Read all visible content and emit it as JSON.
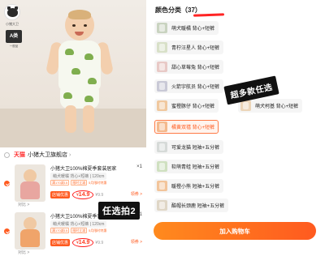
{
  "left": {
    "brand_logo_text": "小猪大卫",
    "grade_badge": "A类",
    "grade_sub": "一般品",
    "store": {
      "platform": "天猫",
      "name": "小猪大卫旗舰店"
    },
    "cart_items": [
      {
        "title": "小猪大卫100%棉夏季套装居家",
        "qty": "×1",
        "sku": "萌犬暖橘 背心+短裤 | 120cm",
        "promo_tags": [
          "满170减15",
          "限时立减",
          "5月限时特惠"
        ],
        "price_label": "店铺优惠",
        "price_currency": "¥",
        "price_value": "14.9",
        "old_price": "¥9.9",
        "coupon_link": "领券 >",
        "thumb_label": "对比 >",
        "thumb_color": "#e8a6a0"
      },
      {
        "title": "小猪大卫100%棉夏季套装居家",
        "qty": "×1",
        "sku": "萌犬暖橘 背心+短裤 | 120cm",
        "promo_tags": [
          "满170减15",
          "限时立减",
          "5月限时特惠"
        ],
        "price_label": "店铺优惠",
        "price_currency": "¥",
        "price_value": "14.9",
        "old_price": "¥9.9",
        "coupon_link": "领券 >",
        "thumb_label": "对比 >",
        "thumb_color": "#f0a46a"
      }
    ],
    "overlay_text": "任选拍2"
  },
  "right": {
    "section_title": "颜色分类（37）",
    "options": [
      {
        "label": "萌犬暖橘 背心+短裤",
        "swatch": "#c9d3c0",
        "selected": false
      },
      {
        "label": "青柠汪星人 背心+短裤",
        "swatch": "#d8e0c8",
        "selected": false
      },
      {
        "label": "甜心草莓兔 背心+短裤",
        "swatch": "#e8c9c6",
        "selected": false
      },
      {
        "label": "火箭宇航员 背心+短裤",
        "swatch": "#c9c9d6",
        "selected": false
      },
      {
        "label": "蜜橙豚仔 背心+短裤",
        "swatch": "#f0c89e",
        "selected": false
      },
      {
        "label": "萌犬柯基 背心+短裤",
        "swatch": "#ecd5b8",
        "selected": false
      },
      {
        "label": "橘黄双禧 背心+短裤",
        "swatch": "#f4b98d",
        "selected": true
      },
      {
        "label": "可爱龙猫 短袖+五分裤",
        "swatch": "#d6dad8",
        "selected": false
      },
      {
        "label": "软萌青蛙 短袖+五分裤",
        "swatch": "#cfe0c0",
        "selected": false
      },
      {
        "label": "暖橙小熊 短袖+五分裤",
        "swatch": "#f2c49a",
        "selected": false
      },
      {
        "label": "酷帽长颈鹿 短袖+五分裤",
        "swatch": "#dfd6c6",
        "selected": false
      }
    ],
    "overlay_text": "超多款任选",
    "add_to_cart": "加入购物车"
  },
  "colors": {
    "accent": "#ff5a1f",
    "tmall_red": "#ff2b2b",
    "circle_red": "#ff1a1a"
  },
  "icons": [
    "pig-logo-icon",
    "check-circle-icon",
    "chevron-right-icon"
  ]
}
